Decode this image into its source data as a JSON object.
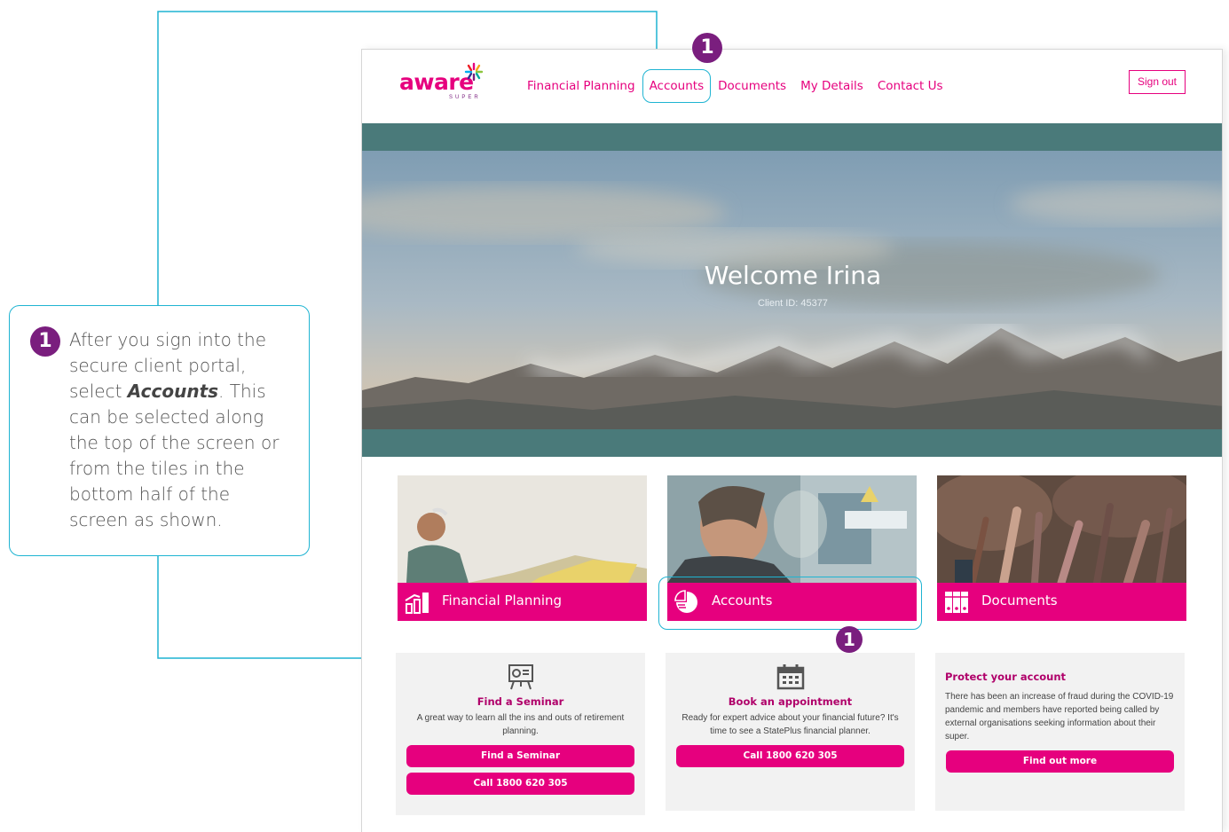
{
  "callout": {
    "step": "1",
    "text_before": "After you sign into the secure client portal, select ",
    "text_emphasis": "Accounts",
    "text_after": ". This can be selected along the top of the screen or from the tiles in the bottom half of the screen as shown."
  },
  "markers": {
    "top": "1",
    "tiles": "1"
  },
  "brand": {
    "logo": "aware",
    "logo_sub": "SUPER",
    "accent": "#e6007e",
    "callout_color": "#1fb4d2",
    "badge_color": "#7a1e7e"
  },
  "nav": {
    "items": [
      "Financial Planning",
      "Accounts",
      "Documents",
      "My Details",
      "Contact Us"
    ],
    "sign_out": "Sign out"
  },
  "hero": {
    "welcome": "Welcome Irina",
    "client_id": "Client ID: 45377"
  },
  "tiles": [
    {
      "label": "Financial Planning",
      "icon": "bar-chart-icon"
    },
    {
      "label": "Accounts",
      "icon": "pie-chart-icon"
    },
    {
      "label": "Documents",
      "icon": "binders-icon"
    }
  ],
  "cards": {
    "seminar": {
      "icon": "presentation-board-icon",
      "title": "Find a Seminar",
      "desc": "A great way to learn all the ins and outs of retirement planning.",
      "btn1": "Find a Seminar",
      "btn2": "Call 1800 620 305"
    },
    "appointment": {
      "icon": "calendar-icon",
      "title": "Book an appointment",
      "desc": "Ready for expert advice about your financial future? It's time to see a StatePlus financial planner.",
      "btn1": "Call 1800 620 305"
    },
    "protect": {
      "title": "Protect your account",
      "desc": "There has been an increase of fraud during the COVID-19 pandemic and members have reported being called by external organisations seeking information about their super.",
      "btn1": "Find out more"
    }
  }
}
